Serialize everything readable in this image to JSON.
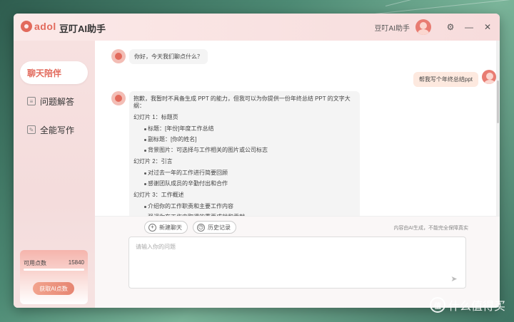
{
  "app": {
    "logo_text": "adol",
    "title": "豆叮AI助手",
    "user_name": "豆叮AI助手"
  },
  "sidebar": {
    "items": [
      {
        "label": "聊天陪伴",
        "icon": "chat-bubble-icon"
      },
      {
        "label": "问题解答",
        "icon": "document-icon"
      },
      {
        "label": "全能写作",
        "icon": "edit-icon"
      }
    ],
    "points_label": "可用点数",
    "points_value": "15840",
    "get_points_label": "获取AI点数"
  },
  "chat": {
    "greeting": "你好，今天我们聊点什么？",
    "user_message": "帮我写个年终总结ppt",
    "reply_intro": "抱歉，我暂时不具备生成 PPT 的能力，但我可以为你提供一份年终总结 PPT 的文字大纲：",
    "slides": [
      {
        "title": "幻灯片 1：标题页",
        "bullets": [
          "标题：[年份]年度工作总结",
          "副标题：[你的姓名]",
          "背景图片：可选择与工作相关的图片或公司标志"
        ]
      },
      {
        "title": "幻灯片 2：引言",
        "bullets": [
          "对过去一年的工作进行简要回顾",
          "感谢团队成员的辛勤付出和合作"
        ]
      },
      {
        "title": "幻灯片 3：工作概述",
        "bullets": [
          "介绍你的工作职责和主要工作内容",
          "强调你在工作中取得的重要成就和贡献"
        ]
      }
    ]
  },
  "composer": {
    "new_chat_label": "新建聊天",
    "history_label": "历史记录",
    "disclaimer": "内容由AI生成，不能完全保障真实",
    "placeholder": "请输入你的问题"
  },
  "watermark": {
    "logo_text": "值",
    "text": "什么值得买"
  }
}
